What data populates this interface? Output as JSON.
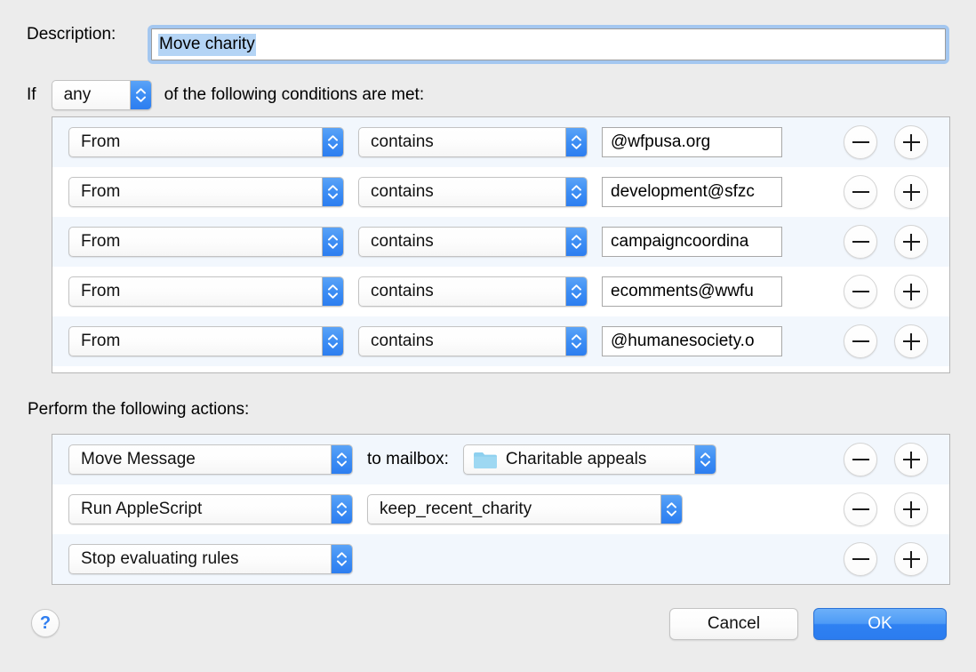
{
  "description": {
    "label": "Description:",
    "value": "Move charity"
  },
  "condition_header": {
    "if_label": "If",
    "match_mode": "any",
    "suffix": "of the following conditions are met:"
  },
  "conditions": [
    {
      "criterion": "From",
      "operator": "contains",
      "value": "@wfpusa.org",
      "minus": "−",
      "plus": "+"
    },
    {
      "criterion": "From",
      "operator": "contains",
      "value": "development@sfzc",
      "minus": "−",
      "plus": "+"
    },
    {
      "criterion": "From",
      "operator": "contains",
      "value": "campaigncoordina",
      "minus": "−",
      "plus": "+"
    },
    {
      "criterion": "From",
      "operator": "contains",
      "value": "ecomments@wwfu",
      "minus": "−",
      "plus": "+"
    },
    {
      "criterion": "From",
      "operator": "contains",
      "value": "@humanesociety.o",
      "minus": "−",
      "plus": "+"
    }
  ],
  "actions_header": "Perform the following actions:",
  "actions": [
    {
      "action": "Move Message",
      "connector": "to mailbox:",
      "target": "Charitable appeals",
      "target_kind": "mailbox"
    },
    {
      "action": "Run AppleScript",
      "connector": "",
      "target": "keep_recent_charity",
      "target_kind": "script"
    },
    {
      "action": "Stop evaluating rules",
      "connector": "",
      "target": "",
      "target_kind": "none"
    }
  ],
  "footer": {
    "help_label": "?",
    "cancel_label": "Cancel",
    "ok_label": "OK"
  },
  "colors": {
    "window_background": "#ececec",
    "accent_blue": "#3d8ef4",
    "row_alt": "#f2f7fd",
    "selection_highlight": "#b4d4f5",
    "focus_ring": "#a4c7f0",
    "folder_icon": "#8dd0ef"
  }
}
